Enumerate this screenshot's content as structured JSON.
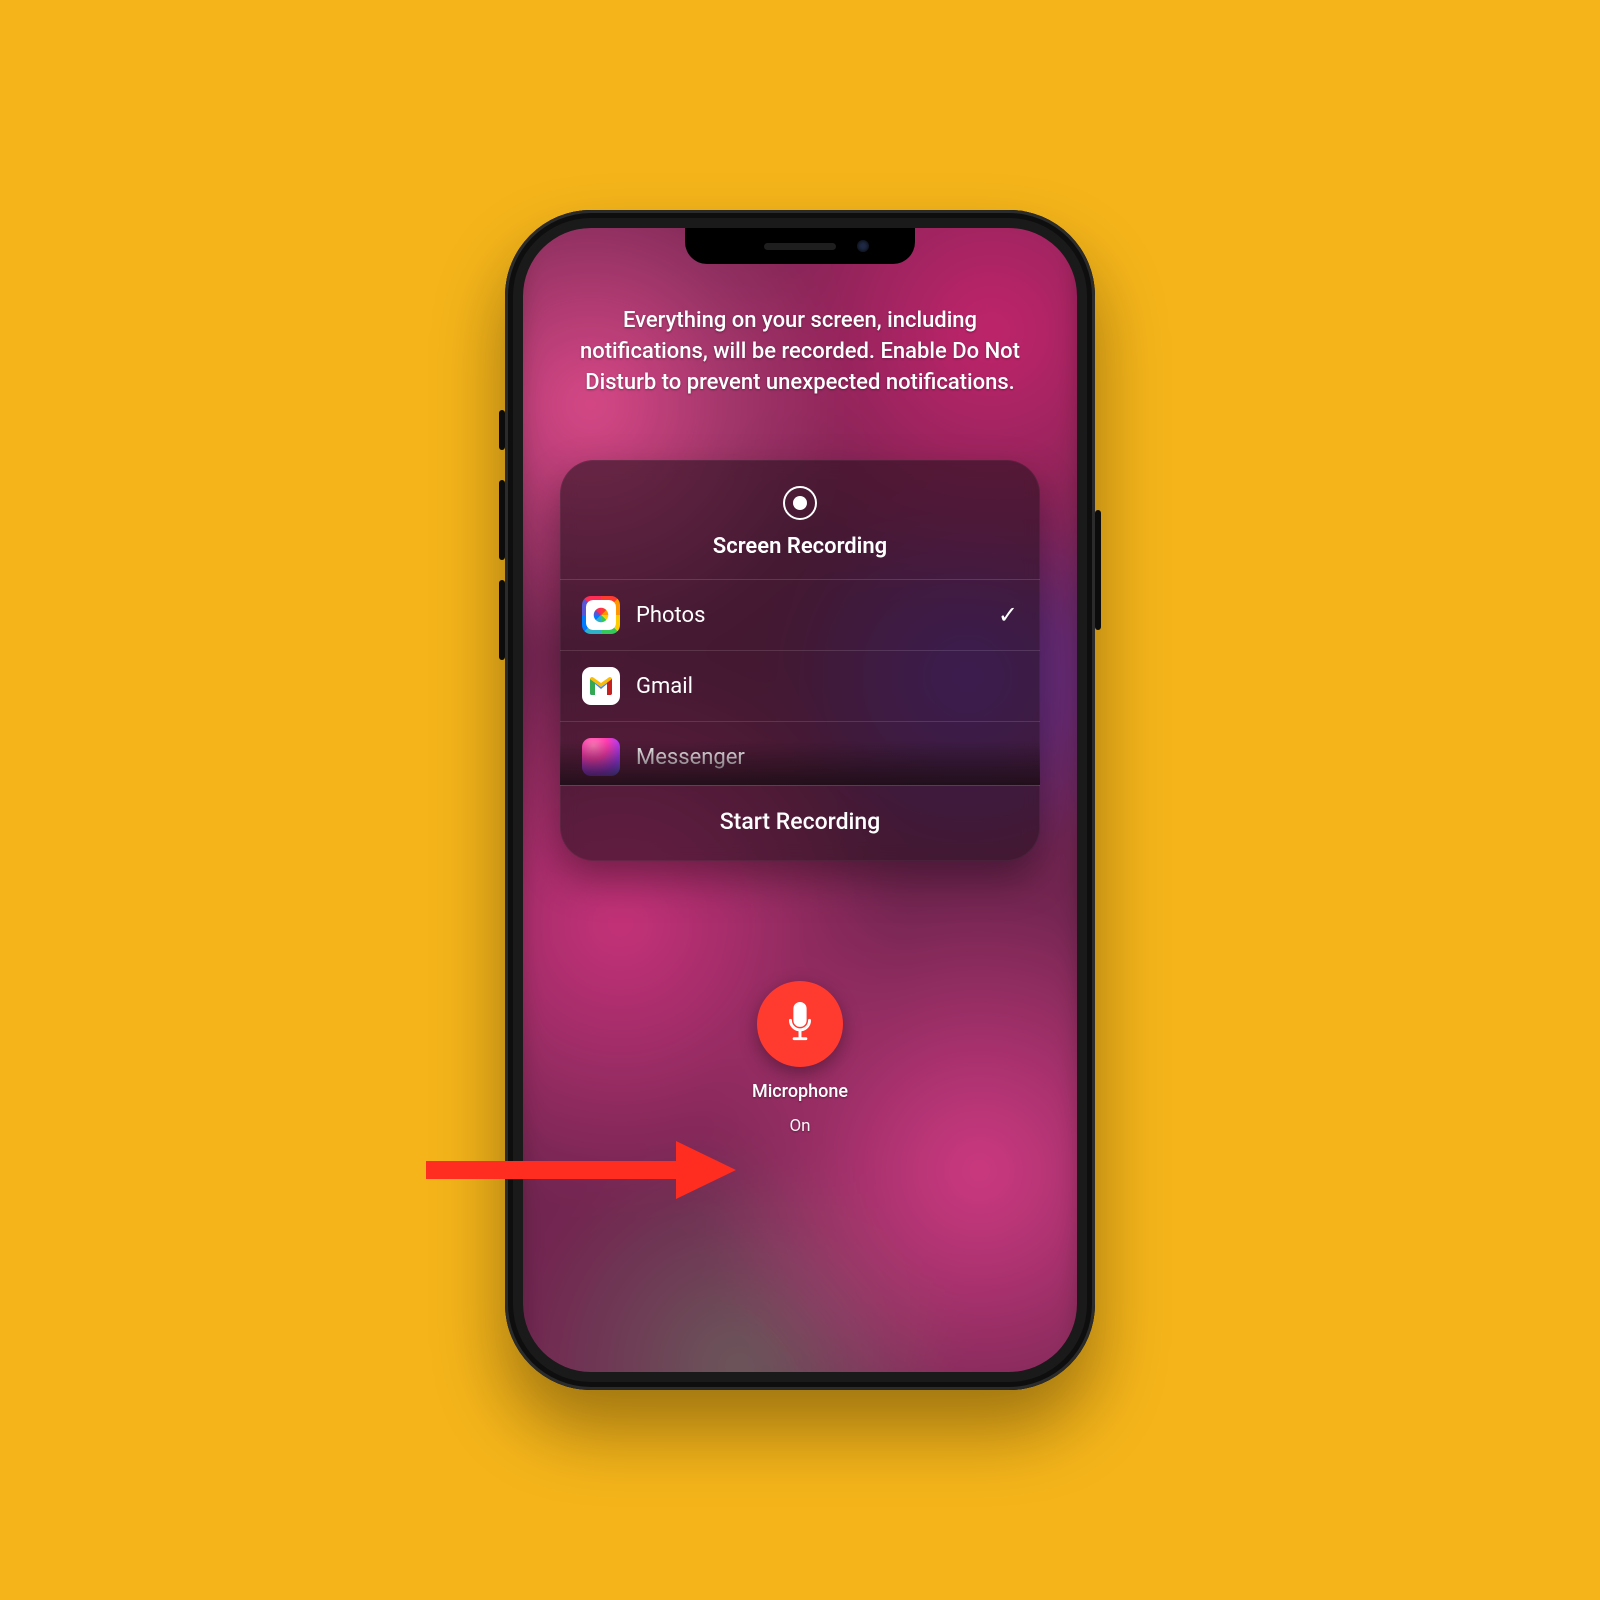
{
  "instruction_text": "Everything on your screen, including notifications, will be recorded. Enable Do Not Disturb to prevent unexpected notifications.",
  "card": {
    "title": "Screen Recording",
    "options": [
      {
        "label": "Photos",
        "selected": true
      },
      {
        "label": "Gmail",
        "selected": false
      },
      {
        "label": "Messenger",
        "selected": false
      }
    ],
    "start_label": "Start Recording"
  },
  "microphone": {
    "label": "Microphone",
    "state": "On"
  },
  "colors": {
    "background": "#f4b41a",
    "accent_red": "#ff3b30"
  }
}
